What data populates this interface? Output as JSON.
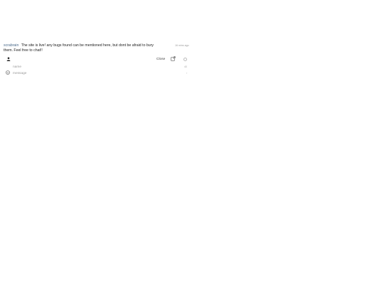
{
  "chat": {
    "message": {
      "author": "scrabrain",
      "text": "The site is live! any bugs found can be mentioned here, but dont be afraid to bury them. Feel free to chat!!",
      "timestamp": "16 mins ago"
    },
    "toolbar": {
      "close_label": "Close"
    },
    "name_input": {
      "placeholder": "name",
      "counter": "40"
    },
    "message_input": {
      "placeholder": "message",
      "send_glyph": "›"
    }
  },
  "icons": {
    "user": "user-icon",
    "popout": "external-link-icon",
    "toggle": "circle-icon",
    "emoji": "smiley-icon"
  }
}
